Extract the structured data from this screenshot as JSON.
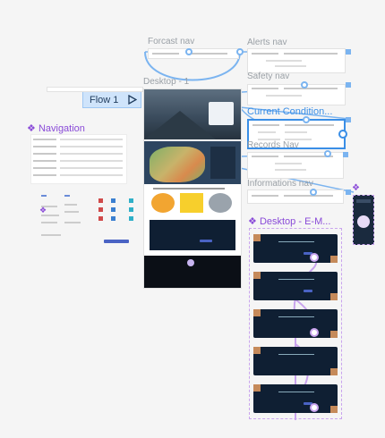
{
  "canvas": {
    "frames": {
      "forecast_nav": "Forcast nav",
      "alerts_nav": "Alerts nav",
      "safety_nav": "Safety nav",
      "current_conditions": "Current Condition...",
      "records_nav": "Records Nav",
      "informations_nav": "Informations nav",
      "desktop_1": "Desktop - 1",
      "desktop_email": "Desktop - E-M...",
      "navigation": "Navigation"
    },
    "flow": {
      "label": "Flow 1"
    }
  },
  "colors": {
    "selection": "#3a8ee6",
    "component": "#8a4bd8",
    "canvas_bg": "#f5f5f5",
    "connector": "#7bb4f0",
    "prototype": "#c9a4ee"
  },
  "icons": [
    "play-icon",
    "component-icon"
  ]
}
